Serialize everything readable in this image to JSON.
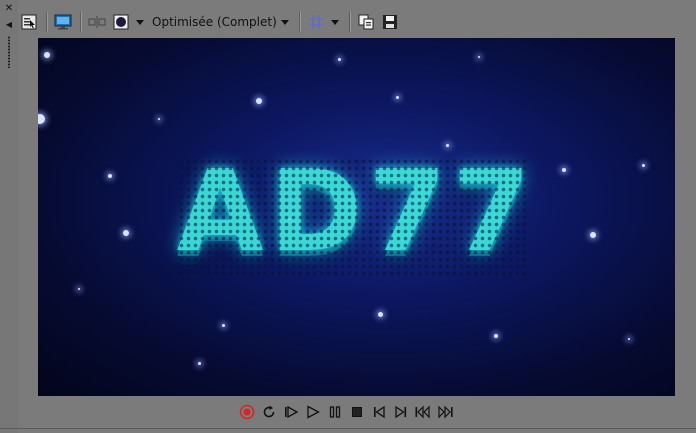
{
  "toolbar": {
    "quality_label": "Optimisée (Complet)",
    "icons": [
      "properties-icon",
      "external-monitor-icon",
      "split-view-icon",
      "adjust-size-icon",
      "overlays-icon",
      "copy-snapshot-icon",
      "save-snapshot-icon"
    ]
  },
  "preview": {
    "title_text": "AD77"
  },
  "transport": {
    "buttons": [
      "record",
      "loop",
      "play-from-start",
      "play",
      "pause",
      "stop",
      "previous-frame",
      "next-frame",
      "go-to-start",
      "go-to-end"
    ]
  },
  "colors": {
    "panel_bg": "#7b7b7b",
    "record_red": "#d6262a",
    "title_cyan": "#3fe8e0",
    "grid_blue": "#5566ee"
  }
}
